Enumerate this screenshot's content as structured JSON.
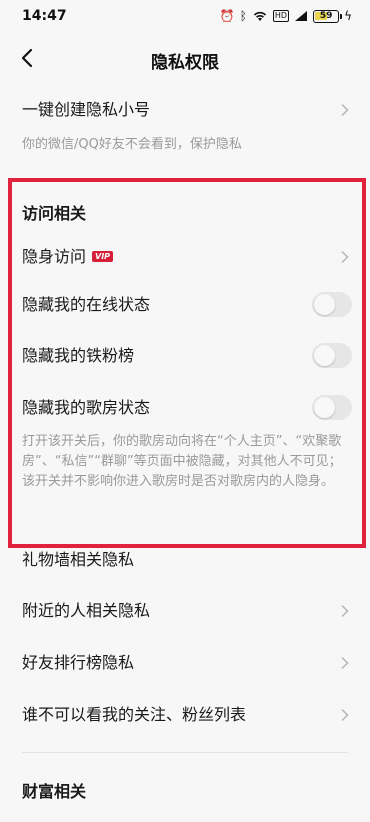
{
  "status_bar": {
    "time": "14:47",
    "battery": "59",
    "hd": "HD"
  },
  "nav": {
    "title": "隐私权限"
  },
  "alt_account": {
    "label": "一键创建隐私小号",
    "desc": "你的微信/QQ好友不会看到，保护隐私"
  },
  "visit_section": {
    "title": "访问相关",
    "stealth_visit": {
      "label": "隐身访问",
      "badge": "VIP"
    },
    "hide_online": {
      "label": "隐藏我的在线状态",
      "on": false
    },
    "hide_fans": {
      "label": "隐藏我的铁粉榜",
      "on": false
    },
    "hide_room": {
      "label": "隐藏我的歌房状态",
      "on": false
    },
    "room_desc": "打开该开关后，你的歌房动向将在“个人主页”、“欢聚歌房”、“私信”“群聊”等页面中被隐藏，对其他人不可见；该开关并不影响你进入歌房时是否对歌房内的人隐身。"
  },
  "menu": {
    "gift_wall": "礼物墙相关隐私",
    "nearby": "附近的人相关隐私",
    "friend_rank": "好友排行榜隐私",
    "follow_list": "谁不可以看我的关注、粉丝列表"
  },
  "wealth_section": {
    "title": "财富相关"
  },
  "colors": {
    "highlight": "#e0223f",
    "vip_badge": "#d6203a",
    "background": "#f7f7f7"
  }
}
